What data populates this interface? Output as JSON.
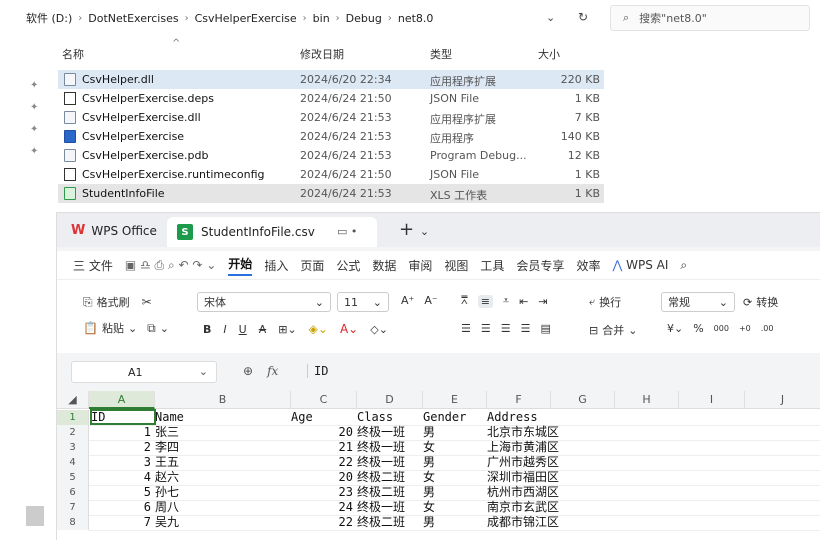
{
  "explorer": {
    "breadcrumb": [
      "软件 (D:)",
      "DotNetExercises",
      "CsvHelperExercise",
      "bin",
      "Debug",
      "net8.0"
    ],
    "search_placeholder": "搜索\"net8.0\"",
    "columns": {
      "name": "名称",
      "date": "修改日期",
      "type": "类型",
      "size": "大小"
    },
    "files": [
      {
        "name": "CsvHelper.dll",
        "date": "2024/6/20 22:34",
        "type": "应用程序扩展",
        "size": "220 KB",
        "icon": "dll-file-icon"
      },
      {
        "name": "CsvHelperExercise.deps",
        "date": "2024/6/24 21:50",
        "type": "JSON File",
        "size": "1 KB",
        "icon": "json-file-icon"
      },
      {
        "name": "CsvHelperExercise.dll",
        "date": "2024/6/24 21:53",
        "type": "应用程序扩展",
        "size": "7 KB",
        "icon": "dll-file-icon"
      },
      {
        "name": "CsvHelperExercise",
        "date": "2024/6/24 21:53",
        "type": "应用程序",
        "size": "140 KB",
        "icon": "exe-file-icon"
      },
      {
        "name": "CsvHelperExercise.pdb",
        "date": "2024/6/24 21:53",
        "type": "Program Debug...",
        "size": "12 KB",
        "icon": "pdb-file-icon"
      },
      {
        "name": "CsvHelperExercise.runtimeconfig",
        "date": "2024/6/24 21:50",
        "type": "JSON File",
        "size": "1 KB",
        "icon": "json-file-icon"
      },
      {
        "name": "StudentInfoFile",
        "date": "2024/6/24 21:53",
        "type": "XLS 工作表",
        "size": "1 KB",
        "icon": "xls-file-icon"
      }
    ]
  },
  "wps": {
    "app_tab": "WPS Office",
    "file_tab": "StudentInfoFile.csv",
    "menu": [
      "三 文件",
      "开始",
      "插入",
      "页面",
      "公式",
      "数据",
      "审阅",
      "视图",
      "工具",
      "会员专享",
      "效率",
      "WPS AI"
    ],
    "ribbon": {
      "format_painter": "格式刷",
      "paste": "粘贴",
      "font": "宋体",
      "font_size": "11",
      "wrap": "换行",
      "merge": "合并",
      "number_format": "常规",
      "convert": "转换",
      "currency": "¥",
      "percent": "%",
      "thousands": "000",
      "dec_inc": "+0",
      "dec_dec": ".00"
    },
    "formula_bar": {
      "cell": "A1",
      "value": "ID"
    },
    "columns": [
      "A",
      "B",
      "C",
      "D",
      "E",
      "F",
      "G",
      "H",
      "I",
      "J"
    ],
    "rows": [
      {
        "num": "1",
        "id": "ID",
        "name": "Name",
        "age": "Age",
        "class": "Class",
        "gender": "Gender",
        "address": "Address"
      },
      {
        "num": "2",
        "id": "1",
        "name": "张三",
        "age": "20",
        "class": "终极一班",
        "gender": "男",
        "address": "北京市东城区"
      },
      {
        "num": "3",
        "id": "2",
        "name": "李四",
        "age": "21",
        "class": "终极一班",
        "gender": "女",
        "address": "上海市黄浦区"
      },
      {
        "num": "4",
        "id": "3",
        "name": "王五",
        "age": "22",
        "class": "终极一班",
        "gender": "男",
        "address": "广州市越秀区"
      },
      {
        "num": "5",
        "id": "4",
        "name": "赵六",
        "age": "20",
        "class": "终极二班",
        "gender": "女",
        "address": "深圳市福田区"
      },
      {
        "num": "6",
        "id": "5",
        "name": "孙七",
        "age": "23",
        "class": "终极二班",
        "gender": "男",
        "address": "杭州市西湖区"
      },
      {
        "num": "7",
        "id": "6",
        "name": "周八",
        "age": "24",
        "class": "终极一班",
        "gender": "女",
        "address": "南京市玄武区"
      },
      {
        "num": "8",
        "id": "7",
        "name": "吴九",
        "age": "22",
        "class": "终极二班",
        "gender": "男",
        "address": "成都市锦江区"
      }
    ]
  }
}
